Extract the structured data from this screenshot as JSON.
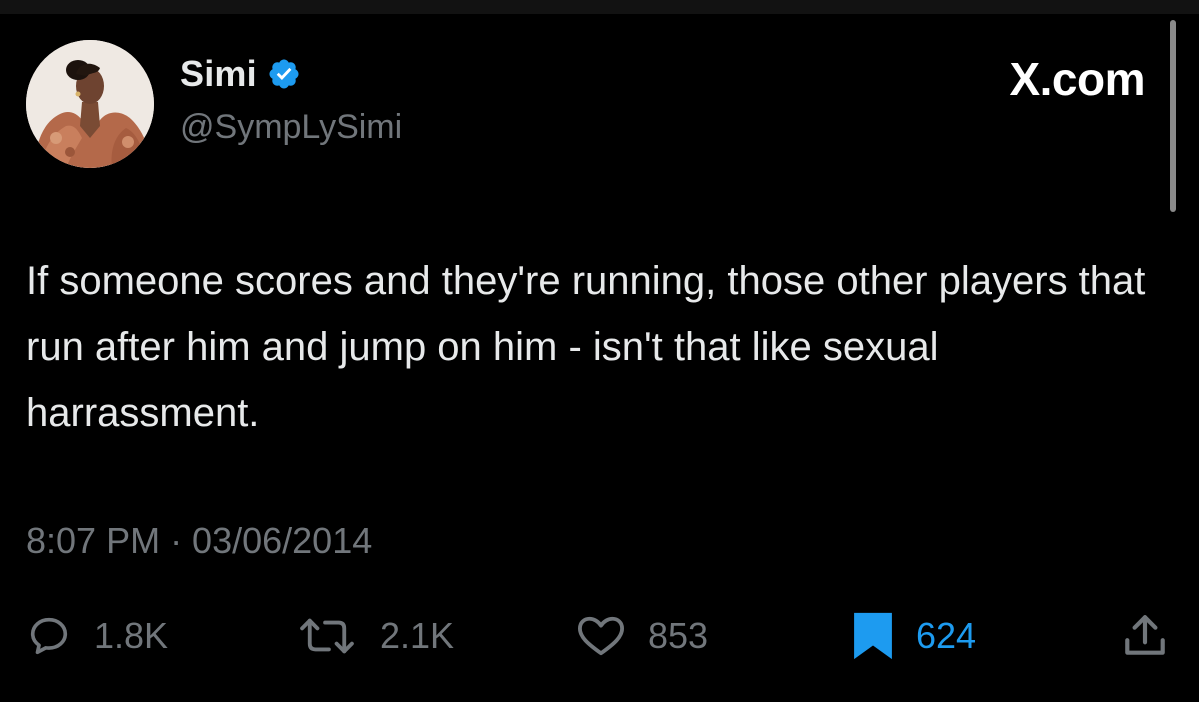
{
  "author": {
    "display_name": "Simi",
    "handle": "@SympLySimi",
    "verified": true,
    "verified_color": "#1d9bf0",
    "avatar_icon": "profile-photo"
  },
  "site_label": "X.com",
  "tweet": {
    "text": "If someone scores and they're running, those other players that run after him and jump on him - isn't that like sexual harrassment.",
    "timestamp": "8:07 PM · 03/06/2014"
  },
  "actions": {
    "replies": {
      "icon": "reply-icon",
      "count": "1.8K"
    },
    "reposts": {
      "icon": "repost-icon",
      "count": "2.1K"
    },
    "likes": {
      "icon": "heart-icon",
      "count": "853"
    },
    "bookmarks": {
      "icon": "bookmark-icon",
      "count": "624",
      "active": true,
      "color": "#1d9bf0"
    },
    "share": {
      "icon": "share-icon"
    }
  },
  "colors": {
    "background": "#000000",
    "text_primary": "#e7e9ea",
    "text_secondary": "#71767b",
    "accent": "#1d9bf0"
  }
}
